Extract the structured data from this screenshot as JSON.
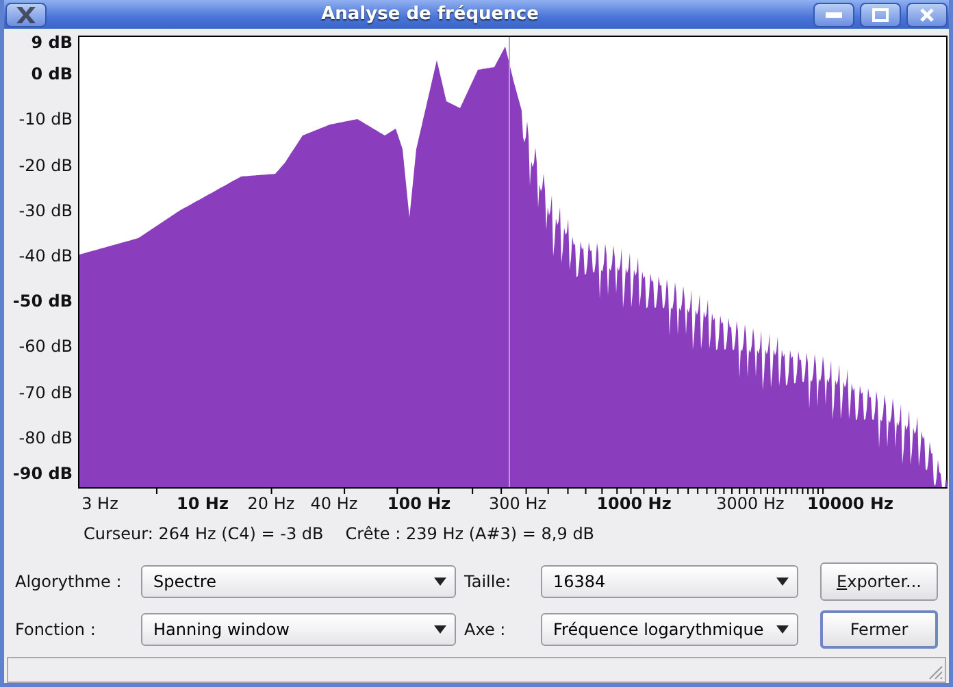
{
  "window": {
    "title": "Analyse de fréquence"
  },
  "y_ticks": [
    {
      "label": "9 dB",
      "bold": true
    },
    {
      "label": "0 dB",
      "bold": true
    },
    {
      "label": "-10 dB",
      "bold": false
    },
    {
      "label": "-20 dB",
      "bold": false
    },
    {
      "label": "-30 dB",
      "bold": false
    },
    {
      "label": "-40 dB",
      "bold": false
    },
    {
      "label": "-50 dB",
      "bold": true
    },
    {
      "label": "-60 dB",
      "bold": false
    },
    {
      "label": "-70 dB",
      "bold": false
    },
    {
      "label": "-80 dB",
      "bold": false
    },
    {
      "label": "-90 dB",
      "bold": true
    }
  ],
  "x_ticks": [
    {
      "label": "3 Hz",
      "bold": false
    },
    {
      "label": "10 Hz",
      "bold": true
    },
    {
      "label": "20 Hz",
      "bold": false
    },
    {
      "label": "40 Hz",
      "bold": false
    },
    {
      "label": "100 Hz",
      "bold": true
    },
    {
      "label": "300 Hz",
      "bold": false
    },
    {
      "label": "1000 Hz",
      "bold": true
    },
    {
      "label": "3000 Hz",
      "bold": false
    },
    {
      "label": "10000 Hz",
      "bold": true
    }
  ],
  "cursor_info": "Curseur: 264 Hz (C4) = -3 dB",
  "peak_info": "Crête : 239 Hz (A#3) = 8,9 dB",
  "rows": [
    {
      "label": "Algorythme :",
      "select": "Spectre",
      "label2": "Taille:",
      "select2": "16384",
      "button": {
        "label": "Exporter...",
        "mnemonic": true,
        "focused": false
      }
    },
    {
      "label": "Fonction :",
      "select": "Hanning window",
      "label2": "Axe :",
      "select2": "Fréquence logarythmique",
      "button": {
        "label": "Fermer",
        "mnemonic": false,
        "focused": true
      }
    }
  ]
}
